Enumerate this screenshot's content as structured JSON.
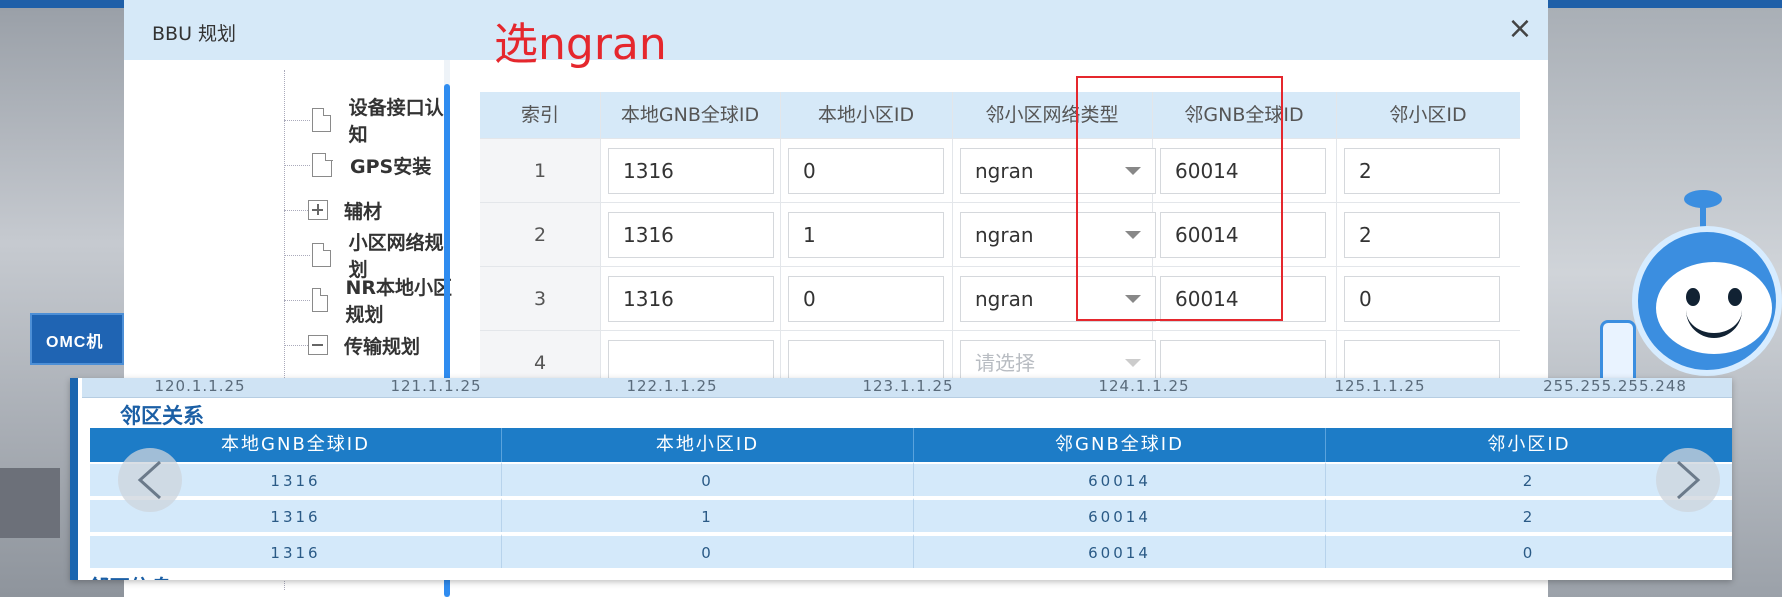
{
  "dialog": {
    "title": "BBU 规划",
    "close_label": "×",
    "annotation": "选ngran"
  },
  "tree": {
    "items": [
      {
        "label": "设备接口认知",
        "icon": "doc-icon"
      },
      {
        "label": "GPS安装",
        "icon": "doc-icon"
      },
      {
        "label": "辅材",
        "icon": "expand-icon"
      },
      {
        "label": "小区网络规划",
        "icon": "doc-icon"
      },
      {
        "label": "NR本地小区规划",
        "icon": "doc-icon"
      },
      {
        "label": "传输规划",
        "icon": "collapse-icon"
      }
    ]
  },
  "grid": {
    "headers": [
      "索引",
      "本地GNB全球ID",
      "本地小区ID",
      "邻小区网络类型",
      "邻GNB全球ID",
      "邻小区ID"
    ],
    "rows": [
      {
        "index": "1",
        "local_gnb": "1316",
        "local_cell": "0",
        "type": "ngran",
        "nb_gnb": "60014",
        "nb_cell": "2"
      },
      {
        "index": "2",
        "local_gnb": "1316",
        "local_cell": "1",
        "type": "ngran",
        "nb_gnb": "60014",
        "nb_cell": "2"
      },
      {
        "index": "3",
        "local_gnb": "1316",
        "local_cell": "0",
        "type": "ngran",
        "nb_gnb": "60014",
        "nb_cell": "0"
      },
      {
        "index": "4",
        "local_gnb": "",
        "local_cell": "",
        "type": "",
        "nb_gnb": "",
        "nb_cell": ""
      }
    ],
    "select_placeholder": "请选择"
  },
  "panel": {
    "ip_row": [
      "120.1.1.25",
      "121.1.1.25",
      "122.1.1.25",
      "123.1.1.25",
      "124.1.1.25",
      "125.1.1.25",
      "255.255.255.248"
    ],
    "title": "邻区关系",
    "headers": [
      "本地GNB全球ID",
      "本地小区ID",
      "邻GNB全球ID",
      "邻小区ID"
    ],
    "rows": [
      [
        "1316",
        "0",
        "60014",
        "2"
      ],
      [
        "1316",
        "1",
        "60014",
        "2"
      ],
      [
        "1316",
        "0",
        "60014",
        "0"
      ]
    ],
    "bottom_title": "邻区信息"
  },
  "background": {
    "sign_text": "OMC机",
    "accent_color": "#1d7cc7",
    "highlight_color": "#e5272d"
  }
}
